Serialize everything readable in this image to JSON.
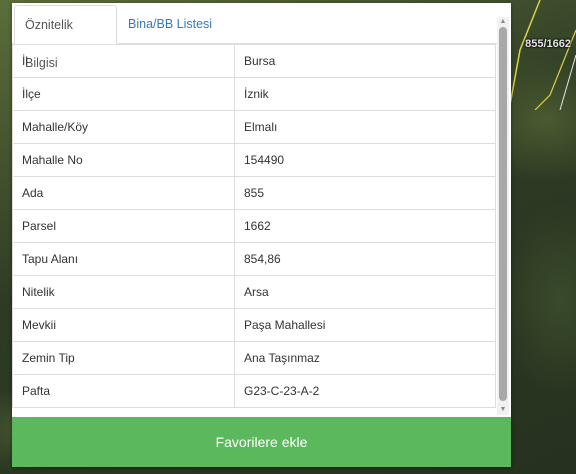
{
  "map": {
    "parcel_label": "855/1662"
  },
  "tabs": [
    {
      "label": "Öznitelik Bilgisi"
    },
    {
      "label": "Bina/BB Listesi"
    }
  ],
  "attributes": [
    {
      "key": "İl",
      "value": "Bursa"
    },
    {
      "key": "İlçe",
      "value": "İznik"
    },
    {
      "key": "Mahalle/Köy",
      "value": "Elmalı"
    },
    {
      "key": "Mahalle No",
      "value": "154490"
    },
    {
      "key": "Ada",
      "value": "855"
    },
    {
      "key": "Parsel",
      "value": "1662"
    },
    {
      "key": "Tapu Alanı",
      "value": "854,86"
    },
    {
      "key": "Nitelik",
      "value": "Arsa"
    },
    {
      "key": "Mevkii",
      "value": "Paşa Mahallesi"
    },
    {
      "key": "Zemin Tip",
      "value": "Ana Taşınmaz"
    },
    {
      "key": "Pafta",
      "value": "G23-C-23-A-2"
    }
  ],
  "actions": {
    "favorite_label": "Favorilere ekle"
  },
  "colors": {
    "accent_green": "#5cb85c",
    "link_blue": "#337ab7",
    "border": "#dddddd"
  }
}
